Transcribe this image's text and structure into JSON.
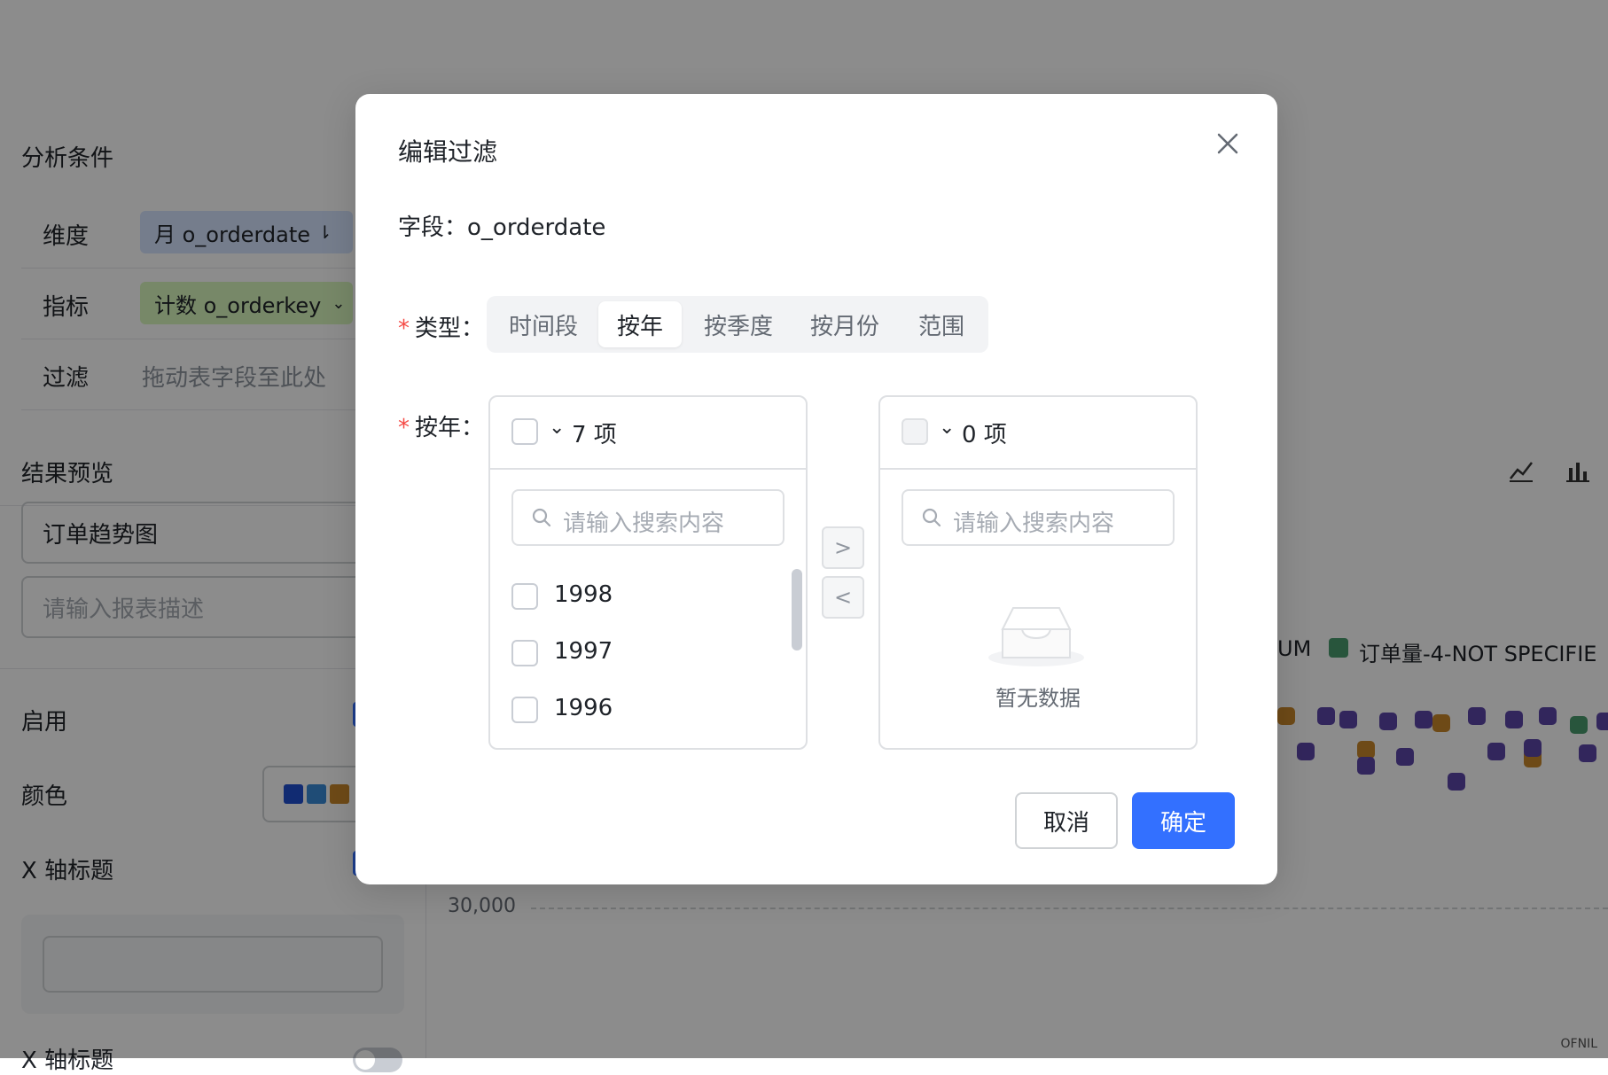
{
  "background": {
    "analysis_section": {
      "title": "分析条件",
      "dimension_label": "维度",
      "dimension_value": "月 o_orderdate",
      "metric_label": "指标",
      "metric_value": "计数 o_orderkey",
      "filter_label": "过滤",
      "filter_placeholder": "拖动表字段至此处"
    },
    "preview_section": {
      "title": "结果预览",
      "report_name": "订单趋势图",
      "report_desc_placeholder": "请输入报表描述",
      "enable_label": "启用",
      "color_label": "颜色",
      "color_swatches": [
        "#1f4fcf",
        "#3a8bd8",
        "#c9872a"
      ],
      "x_axis_title_label": "X 轴标题",
      "x_axis_title_label_2": "X 轴标题"
    },
    "chart": {
      "legend_partial_1": "UM",
      "legend_partial_2": "订单量-4-NOT SPECIFIE",
      "legend_color": "#4a9b6e",
      "y_tick_label": "30,000"
    },
    "watermark": "OFNIL"
  },
  "modal": {
    "title": "编辑过滤",
    "field_line": "字段：o_orderdate",
    "type_label": "类型：",
    "type_required_mark": "*",
    "type_tabs": [
      {
        "label": "时间段",
        "active": false
      },
      {
        "label": "按年",
        "active": true
      },
      {
        "label": "按季度",
        "active": false
      },
      {
        "label": "按月份",
        "active": false
      },
      {
        "label": "范围",
        "active": false
      }
    ],
    "year_label": "按年：",
    "year_required_mark": "*",
    "left_panel": {
      "count_text": "7 项",
      "search_placeholder": "请输入搜索内容",
      "items": [
        "1998",
        "1997",
        "1996"
      ]
    },
    "right_panel": {
      "count_text": "0 项",
      "search_placeholder": "请输入搜索内容",
      "empty_text": "暂无数据"
    },
    "move_right_symbol": ">",
    "move_left_symbol": "<",
    "cancel_label": "取消",
    "confirm_label": "确定"
  }
}
